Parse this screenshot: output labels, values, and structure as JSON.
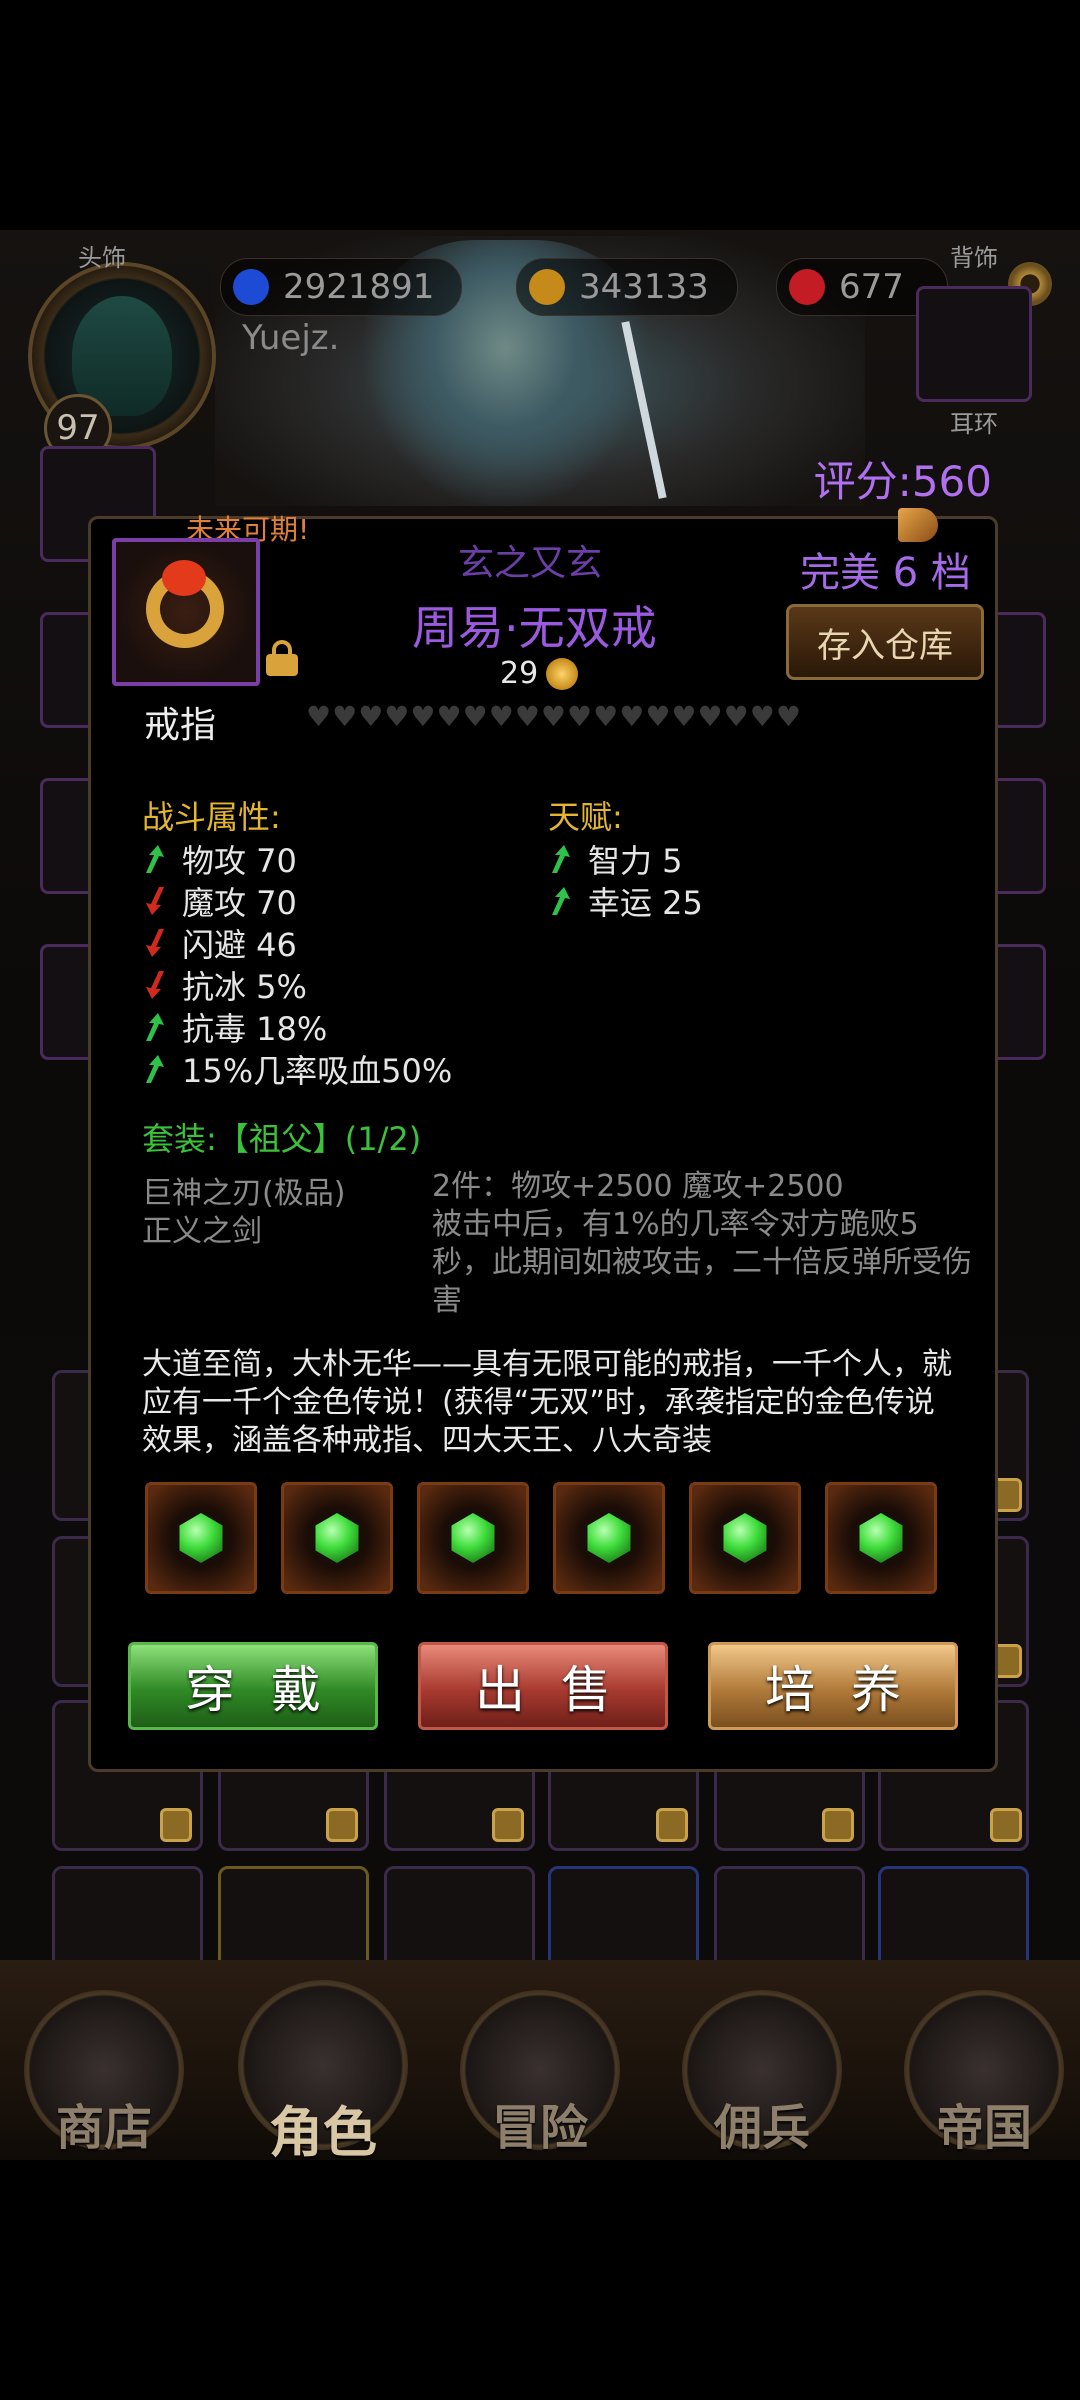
{
  "header": {
    "currencies": [
      {
        "icon": "blue-diamond-icon",
        "value": "2921891"
      },
      {
        "icon": "gold-coin-icon",
        "value": "343133"
      },
      {
        "icon": "red-gem-icon",
        "value": "677"
      }
    ],
    "player_name": "Yuejz.",
    "level": "97",
    "score": "评分:560"
  },
  "equipment_slots": {
    "head_label": "头饰",
    "back_label": "背饰",
    "earring_label": "耳环"
  },
  "item": {
    "tag": "未来可期!",
    "series": "玄之又玄",
    "name": "周易·无双戒",
    "level": "29",
    "perfect_tier": "完美 6 档",
    "store_button": "存入仓库",
    "type": "戒指",
    "hearts": "♥♥♥♥♥♥♥♥♥♥♥♥♥♥♥♥♥♥♥",
    "combat_title": "战斗属性:",
    "combat_attrs": [
      {
        "text": "物攻 70",
        "trend": "up"
      },
      {
        "text": "魔攻 70",
        "trend": "down"
      },
      {
        "text": "闪避 46",
        "trend": "down"
      },
      {
        "text": "抗冰 5%",
        "trend": "down"
      },
      {
        "text": "抗毒 18%",
        "trend": "up"
      },
      {
        "text": "15%几率吸血50%",
        "trend": "up"
      }
    ],
    "talent_title": "天赋:",
    "talent_attrs": [
      {
        "text": "智力 5",
        "trend": "up"
      },
      {
        "text": "幸运 25",
        "trend": "up"
      }
    ],
    "set_title": "套装:【祖父】(1/2)",
    "set_pieces": [
      "巨神之刃(极品)",
      "正义之剑"
    ],
    "set_effects": [
      "2件：物攻+2500 魔攻+2500",
      "被击中后，有1%的几率令对方跪败5秒，此期间如被攻击，二十倍反弹所受伤害"
    ],
    "description": "大道至简，大朴无华——具有无限可能的戒指，一千个人，就应有一千个金色传说！(获得“无双”时，承袭指定的金色传说效果，涵盖各种戒指、四大天王、八大奇装",
    "gems": [
      "emerald",
      "emerald",
      "emerald",
      "emerald",
      "emerald",
      "emerald"
    ]
  },
  "actions": {
    "wear": "穿戴",
    "sell": "出售",
    "train": "培养"
  },
  "nav": [
    {
      "label": "商店",
      "icon": "shop-castle-icon"
    },
    {
      "label": "角色",
      "icon": "character-hood-icon"
    },
    {
      "label": "冒险",
      "icon": "crossed-swords-icon"
    },
    {
      "label": "佣兵",
      "icon": "mercenary-icon"
    },
    {
      "label": "帝国",
      "icon": "crown-icon"
    }
  ],
  "colors": {
    "accent_purple": "#9c5ae0",
    "gold_text": "#e4b530",
    "set_green": "#3ac33a",
    "wear_green": "#2f8a25",
    "sell_red": "#a83a30",
    "train_gold": "#b07a3a"
  }
}
